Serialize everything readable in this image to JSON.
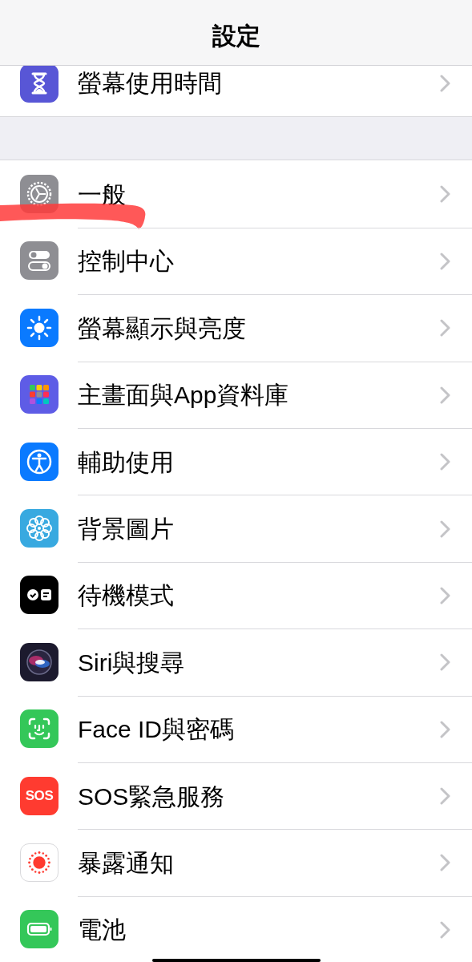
{
  "navigation_bar": {
    "title": "設定"
  },
  "sections": [
    {
      "items": [
        {
          "label": "螢幕使用時間",
          "color": "#5856d6"
        }
      ]
    },
    {
      "items": [
        {
          "label": "一般",
          "color": "#8e8e93",
          "marker_stroke": true
        },
        {
          "label": "控制中心",
          "color": "#8e8e93"
        },
        {
          "label": "螢幕顯示與亮度",
          "color": "#0a7aff"
        },
        {
          "label": "主畫面與App資料庫",
          "color": "#5e5ce6"
        },
        {
          "label": "輔助使用",
          "color": "#0a7aff"
        },
        {
          "label": "背景圖片",
          "color": "#38a9e0"
        },
        {
          "label": "待機模式",
          "color": "#000000"
        },
        {
          "label": "Siri與搜尋",
          "color": "#1c1a2e"
        },
        {
          "label": "Face ID與密碼",
          "color": "#34c759"
        },
        {
          "label": "SOS緊急服務",
          "color": "#ff3b30",
          "icon_text": "SOS"
        },
        {
          "label": "暴露通知",
          "color": "#ffffff"
        },
        {
          "label": "電池",
          "color": "#34c759"
        }
      ]
    }
  ]
}
